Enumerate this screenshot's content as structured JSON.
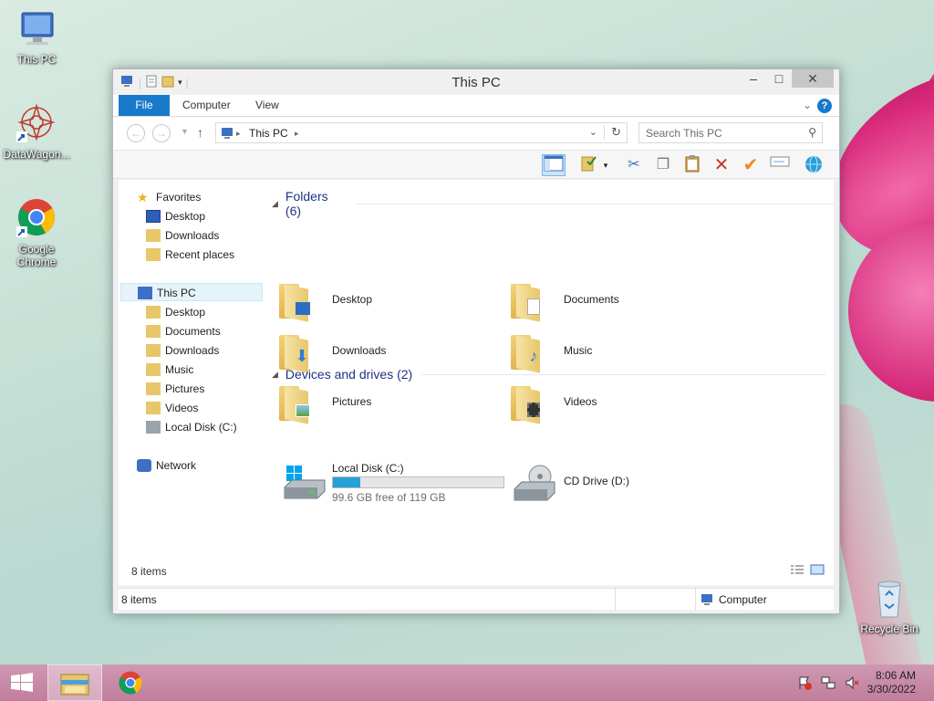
{
  "desktop": {
    "icons": [
      {
        "label": "This PC"
      },
      {
        "label": "DataWagon..."
      },
      {
        "label": "Google Chrome"
      },
      {
        "label": "Recycle Bin"
      }
    ]
  },
  "window": {
    "title": "This PC",
    "ribbon_tabs": [
      "File",
      "Computer",
      "View"
    ],
    "address": {
      "crumb": "This PC"
    },
    "search": {
      "placeholder": "Search This PC"
    },
    "nav": {
      "favorites": "Favorites",
      "favorite_items": [
        "Desktop",
        "Downloads",
        "Recent places"
      ],
      "this_pc": "This PC",
      "pc_items": [
        "Desktop",
        "Documents",
        "Downloads",
        "Music",
        "Pictures",
        "Videos",
        "Local Disk (C:)"
      ],
      "network": "Network"
    },
    "folders_header": "Folders (6)",
    "folders": [
      "Desktop",
      "Documents",
      "Downloads",
      "Music",
      "Pictures",
      "Videos"
    ],
    "devices_header": "Devices and drives (2)",
    "drives": [
      {
        "name": "Local Disk (C:)",
        "free": "99.6 GB free of 119 GB",
        "used_fraction": 0.163
      },
      {
        "name": "CD Drive (D:)"
      }
    ],
    "inner_status": "8 items",
    "status": {
      "left": "8 items",
      "right": "Computer"
    }
  },
  "taskbar": {
    "time": "8:06 AM",
    "date": "3/30/2022"
  },
  "colors": {
    "accent": "#1979ca",
    "drive_bar": "#26a0da",
    "taskbar": "#c78aa6"
  }
}
